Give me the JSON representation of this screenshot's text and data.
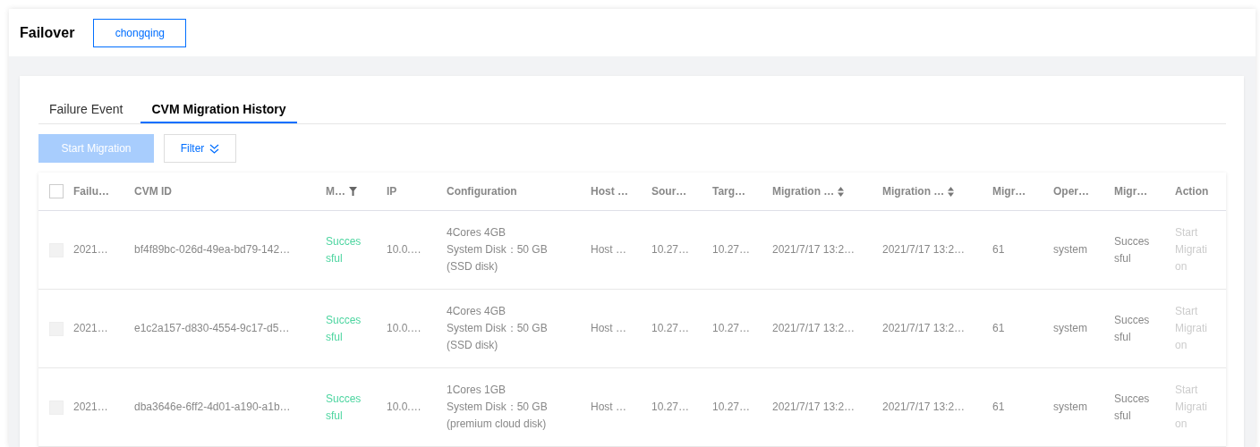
{
  "header": {
    "title": "Failover",
    "region": "chongqing"
  },
  "tabs": [
    {
      "label": "Failure Event",
      "selected": false
    },
    {
      "label": "CVM Migration History",
      "selected": true
    }
  ],
  "toolbar": {
    "start_button": {
      "label": "Start Migration",
      "disabled": true
    },
    "filter_button": {
      "label": "Filter"
    }
  },
  "table": {
    "select_all": {
      "checked": false
    },
    "columns": [
      {
        "label": "Failu…",
        "filterable": false,
        "sortable": false
      },
      {
        "label": "CVM ID",
        "filterable": false,
        "sortable": false
      },
      {
        "label": "M…",
        "filterable": true,
        "sortable": false
      },
      {
        "label": "IP",
        "filterable": false,
        "sortable": false
      },
      {
        "label": "Configuration",
        "filterable": false,
        "sortable": false
      },
      {
        "label": "Host …",
        "filterable": false,
        "sortable": false
      },
      {
        "label": "Sour…",
        "filterable": false,
        "sortable": false
      },
      {
        "label": "Targ…",
        "filterable": false,
        "sortable": false
      },
      {
        "label": "Migration …",
        "filterable": false,
        "sortable": true
      },
      {
        "label": "Migration …",
        "filterable": false,
        "sortable": true
      },
      {
        "label": "Migr…",
        "filterable": false,
        "sortable": false
      },
      {
        "label": "Oper…",
        "filterable": false,
        "sortable": false
      },
      {
        "label": "Migr…",
        "filterable": false,
        "sortable": false
      },
      {
        "label": "Action",
        "filterable": false,
        "sortable": false
      }
    ],
    "rows": [
      {
        "checked": false,
        "disabled": true,
        "failure": "2021…",
        "cvm_id": "bf4f89bc-026d-49ea-bd79-142…",
        "status": {
          "text": "Successful",
          "kind": "success"
        },
        "ip": "10.0.…",
        "configuration": [
          "4Cores 4GB",
          "System Disk：50 GB",
          "(SSD disk)"
        ],
        "host": "Host …",
        "source": "10.27…",
        "target": "10.27…",
        "start_time": "2021/7/17 13:2…",
        "end_time": "2021/7/17 13:2…",
        "duration": "61",
        "operator": "system",
        "result": "Successful",
        "action": {
          "label": "Start Migration",
          "disabled": true
        }
      },
      {
        "checked": false,
        "disabled": true,
        "failure": "2021…",
        "cvm_id": "e1c2a157-d830-4554-9c17-d5…",
        "status": {
          "text": "Successful",
          "kind": "success"
        },
        "ip": "10.0.…",
        "configuration": [
          "4Cores 4GB",
          "System Disk：50 GB",
          "(SSD disk)"
        ],
        "host": "Host …",
        "source": "10.27…",
        "target": "10.27…",
        "start_time": "2021/7/17 13:2…",
        "end_time": "2021/7/17 13:2…",
        "duration": "61",
        "operator": "system",
        "result": "Successful",
        "action": {
          "label": "Start Migration",
          "disabled": true
        }
      },
      {
        "checked": false,
        "disabled": true,
        "failure": "2021…",
        "cvm_id": "dba3646e-6ff2-4d01-a190-a1b…",
        "status": {
          "text": "Successful",
          "kind": "success"
        },
        "ip": "10.0.…",
        "configuration": [
          "1Cores 1GB",
          "System Disk：50 GB",
          "(premium cloud disk)"
        ],
        "host": "Host …",
        "source": "10.27…",
        "target": "10.27…",
        "start_time": "2021/7/17 13:2…",
        "end_time": "2021/7/17 13:2…",
        "duration": "61",
        "operator": "system",
        "result": "Successful",
        "action": {
          "label": "Start Migration",
          "disabled": true
        }
      }
    ]
  }
}
